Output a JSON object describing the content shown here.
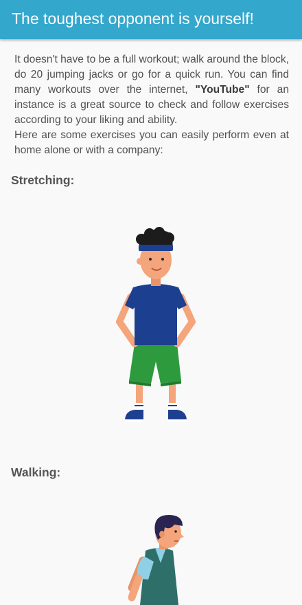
{
  "header": {
    "title": "The toughest opponent is yourself!"
  },
  "intro": {
    "text_before": "It doesn't have to be a full workout; walk around the block, do 20 jumping jacks or go for a quick run. You can find many workouts over the internet, ",
    "highlight": "\"YouTube\"",
    "text_after": " for an instance is a great source to check and follow exercises according to your liking and ability.",
    "second_paragraph": "Here are some exercises you can easily perform even at home alone or with a company:"
  },
  "sections": [
    {
      "heading": "Stretching:",
      "illustration": "stretching-man-illustration"
    },
    {
      "heading": "Walking:",
      "illustration": "walking-man-illustration"
    }
  ],
  "colors": {
    "header_bg": "#34a7cc",
    "page_bg": "#f9f9f9",
    "shirt_blue": "#1d3f8f",
    "shorts_green": "#2d9a3e",
    "skin": "#f4a57c",
    "vest_teal": "#2e6f6a"
  }
}
